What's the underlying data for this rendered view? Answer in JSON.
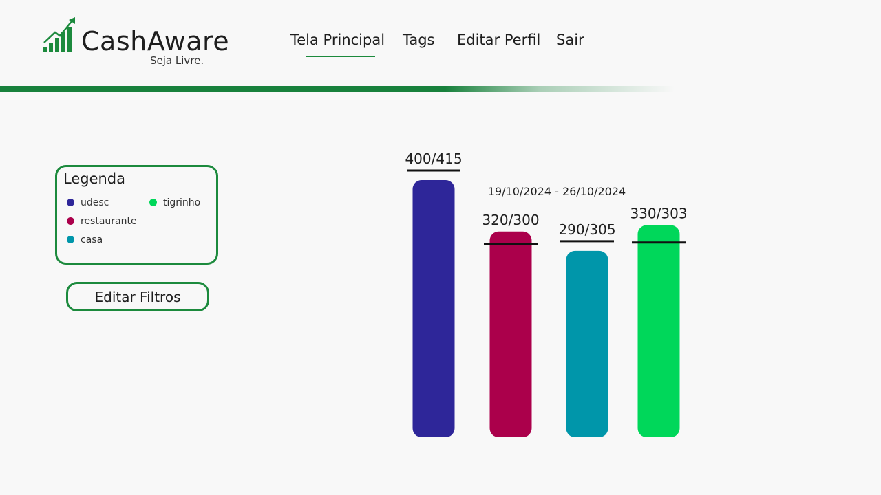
{
  "header": {
    "brand": "CashAware",
    "tagline": "Seja Livre.",
    "nav": [
      {
        "label": "Tela Principal",
        "active": true
      },
      {
        "label": "Tags",
        "active": false
      },
      {
        "label": "Editar Perfil",
        "active": false
      },
      {
        "label": "Sair",
        "active": false
      }
    ]
  },
  "colors": {
    "accent": "#1c8a3d",
    "udesc": "#2e2699",
    "restaurante": "#ab004b",
    "casa": "#0096aa",
    "tigrinho": "#00d75a"
  },
  "legend": {
    "title": "Legenda",
    "items": [
      {
        "label": "udesc",
        "color": "#2e2699"
      },
      {
        "label": "restaurante",
        "color": "#ab004b"
      },
      {
        "label": "casa",
        "color": "#0096aa"
      },
      {
        "label": "tigrinho",
        "color": "#00d75a"
      }
    ]
  },
  "filters": {
    "edit_label": "Editar Filtros"
  },
  "chart_data": {
    "type": "bar",
    "title": "19/10/2024 - 26/10/2024",
    "categories": [
      "udesc",
      "restaurante",
      "casa",
      "tigrinho"
    ],
    "labels": [
      "400/415",
      "320/300",
      "290/305",
      "330/303"
    ],
    "values": [
      400,
      320,
      290,
      330
    ],
    "limits": [
      415,
      300,
      305,
      303
    ],
    "colors": [
      "#2e2699",
      "#ab004b",
      "#0096aa",
      "#00d75a"
    ]
  }
}
